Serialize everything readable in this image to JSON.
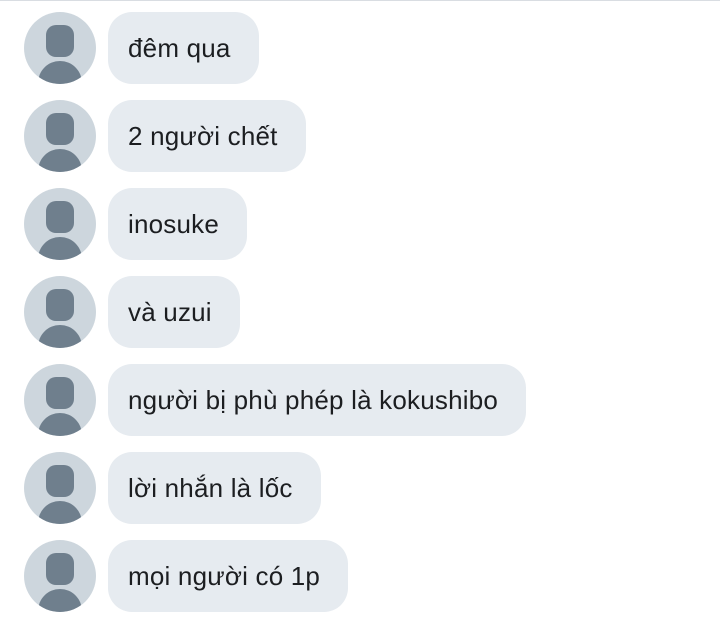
{
  "colors": {
    "bubble_background": "#e6ebf0",
    "avatar_background": "#cdd6dd",
    "avatar_figure": "#6f7f8d",
    "text": "#1c1e21"
  },
  "messages": [
    {
      "avatar_icon": "default-user-icon",
      "text": "đêm qua"
    },
    {
      "avatar_icon": "default-user-icon",
      "text": "2 người chết"
    },
    {
      "avatar_icon": "default-user-icon",
      "text": "inosuke"
    },
    {
      "avatar_icon": "default-user-icon",
      "text": "và uzui"
    },
    {
      "avatar_icon": "default-user-icon",
      "text": "người bị phù phép là kokushibo"
    },
    {
      "avatar_icon": "default-user-icon",
      "text": "lời nhắn là lốc"
    },
    {
      "avatar_icon": "default-user-icon",
      "text": "mọi người có 1p"
    }
  ]
}
